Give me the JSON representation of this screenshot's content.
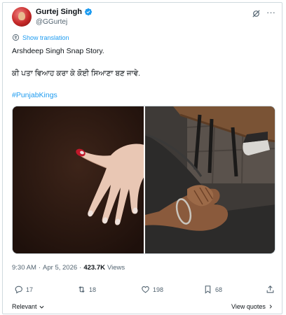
{
  "author": {
    "name": "Gurtej Singh",
    "handle": "@GGurtej"
  },
  "translation": {
    "label": "Show translation"
  },
  "post": {
    "line1": "Arshdeep Singh Snap Story.",
    "line2": "ਕੀ ਪਤਾ ਵਿਆਹ ਕਰਾ ਕੇ ਕੋਈ ਸਿਆਣਾ ਬਣ ਜਾਵੇ.",
    "hashtag": "#PunjabKings"
  },
  "meta": {
    "time": "9:30 AM",
    "sep1": "·",
    "date": "Apr 5, 2026",
    "sep2": "·",
    "views_count": "423.7K",
    "views_label": "Views"
  },
  "actions": {
    "replies": "17",
    "reposts": "18",
    "likes": "198",
    "bookmarks": "68"
  },
  "footer": {
    "relevant_label": "Relevant",
    "view_quotes_label": "View quotes"
  },
  "colors": {
    "accent": "#1d9bf0",
    "secondary_text": "#536471",
    "border": "#cfd9de"
  },
  "icons": [
    "verified-badge-icon",
    "grok-icon",
    "more-icon",
    "translate-icon",
    "reply-icon",
    "repost-icon",
    "like-icon",
    "bookmark-icon",
    "share-icon",
    "chevron-down-icon",
    "chevron-right-icon"
  ]
}
